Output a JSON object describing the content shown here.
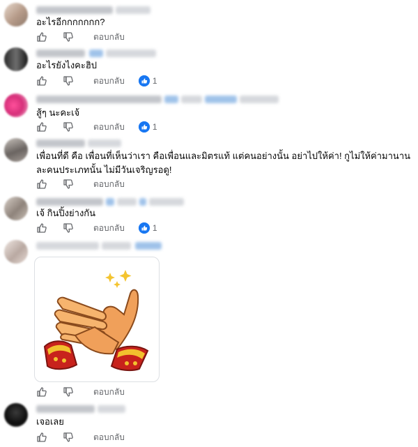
{
  "colors": {
    "link_blue": "#1877f2",
    "muted": "#65676b",
    "text": "#050505"
  },
  "comments": [
    {
      "text": "อะไรอีกกกกกกก?",
      "reply_label": "ตอบกลับ",
      "reaction_count": null
    },
    {
      "text": "อะไรยังไงคะฮิป",
      "reply_label": "ตอบกลับ",
      "reaction_count": "1"
    },
    {
      "text": "สู้ๆ นะคะเจ้",
      "reply_label": "ตอบกลับ",
      "reaction_count": "1"
    },
    {
      "text_line1": "เพื่อนที่ดี คือ เพื่อนที่เห็นว่าเรา คือเพื่อนและมิตรแท้ แต่คนอย่างนั้น อย่าไปให้ค่า! กูไม่ให้ค่ามานาน",
      "text_line2": "ละคนประเภทนั้น ไม่มีวันเจริญรอดู!",
      "reply_label": "ตอบกลับ",
      "reaction_count": null
    },
    {
      "text": "เจ้ กินปิ้งย่างกัน",
      "reply_label": "ตอบกลับ",
      "reaction_count": "1"
    },
    {
      "sticker": "clapping-hands-sticker",
      "reply_label": "ตอบกลับ",
      "reaction_count": null
    },
    {
      "text": "เจอเลย",
      "reply_label": "ตอบกลับ",
      "reaction_count": null
    }
  ],
  "icons": {
    "like": "thumbs-up-icon",
    "dislike": "thumbs-down-icon",
    "reaction": "like-reaction-icon"
  }
}
